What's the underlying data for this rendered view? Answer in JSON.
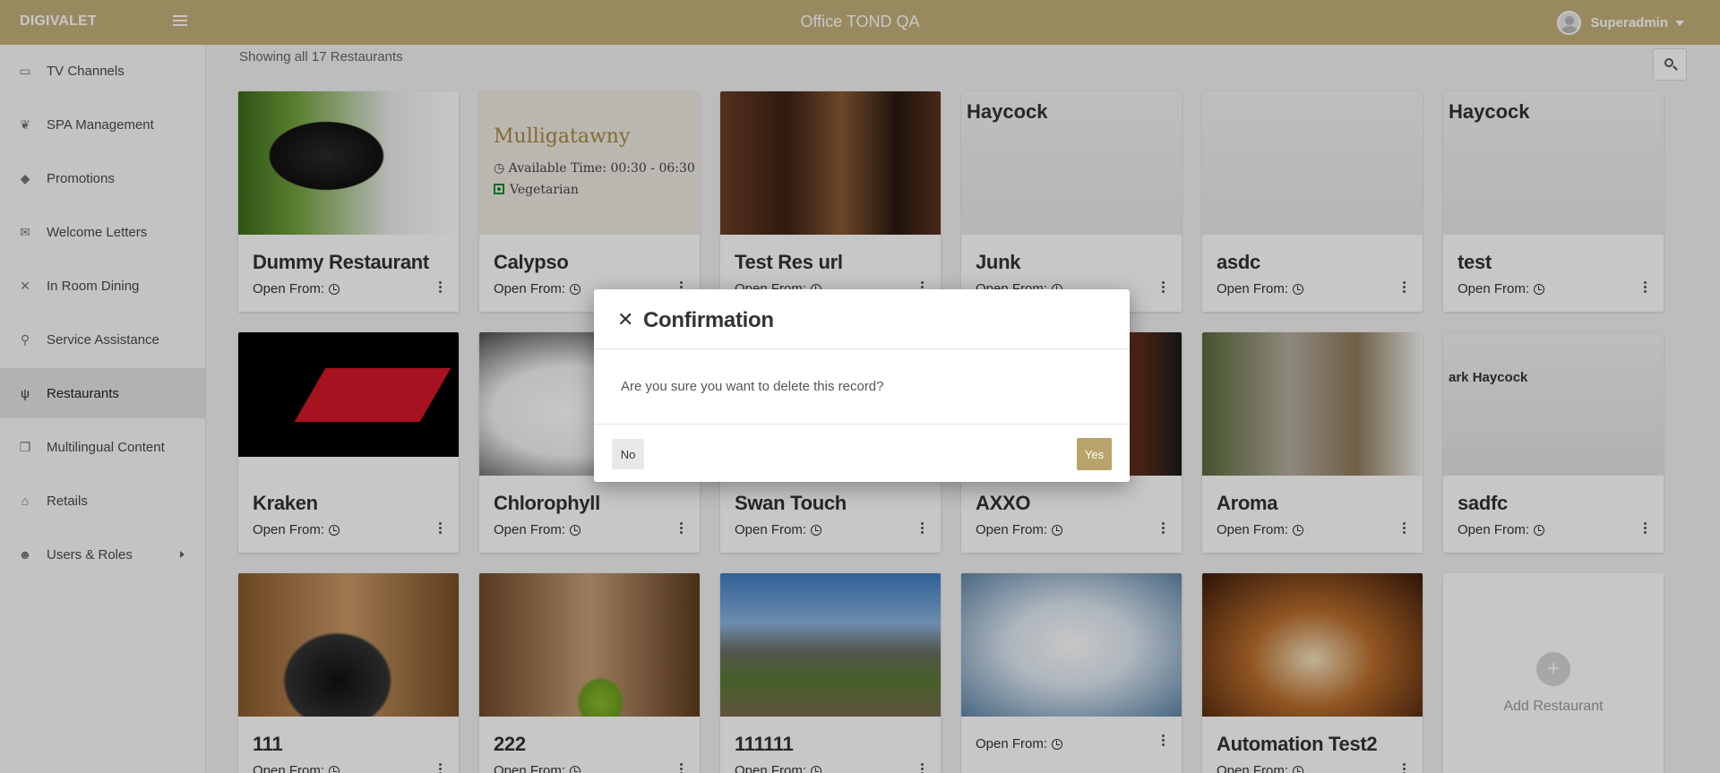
{
  "header": {
    "brand": "DIGIVALET",
    "app_title": "Office TOND QA",
    "user_name": "Superadmin"
  },
  "sidebar": {
    "items": [
      {
        "label": "TV Channels",
        "icon": "tv-icon"
      },
      {
        "label": "SPA Management",
        "icon": "spa-icon"
      },
      {
        "label": "Promotions",
        "icon": "tag-icon"
      },
      {
        "label": "Welcome Letters",
        "icon": "envelope-icon"
      },
      {
        "label": "In Room Dining",
        "icon": "cutlery-icon"
      },
      {
        "label": "Service Assistance",
        "icon": "bell-icon"
      },
      {
        "label": "Restaurants",
        "icon": "fork-knife-icon",
        "active": true
      },
      {
        "label": "Multilingual Content",
        "icon": "copy-icon"
      },
      {
        "label": "Retails",
        "icon": "basket-icon"
      },
      {
        "label": "Users & Roles",
        "icon": "user-icon"
      }
    ]
  },
  "main": {
    "showing_text": "Showing all 17 Restaurants",
    "open_from_label": "Open From:",
    "add_label": "Add Restaurant",
    "mulligatawny": {
      "title": "Mulligatawny",
      "time": "Available Time: 00:30 - 06:30",
      "diet": "Vegetarian"
    },
    "haycock_text": "Haycock",
    "restaurants": [
      {
        "name": "Dummy Restaurant"
      },
      {
        "name": "Calypso"
      },
      {
        "name": "Test Res url"
      },
      {
        "name": "Junk"
      },
      {
        "name": "asdc"
      },
      {
        "name": "test"
      },
      {
        "name": "Kraken"
      },
      {
        "name": "Chlorophyll"
      },
      {
        "name": "Swan Touch"
      },
      {
        "name": "AXXO"
      },
      {
        "name": "Aroma"
      },
      {
        "name": "sadfc"
      },
      {
        "name": "111"
      },
      {
        "name": "222"
      },
      {
        "name": "111111"
      },
      {
        "name": ""
      },
      {
        "name": "Automation Test2"
      }
    ]
  },
  "modal": {
    "title": "Confirmation",
    "message": "Are you sure you want to delete this record?",
    "no_label": "No",
    "yes_label": "Yes"
  },
  "colors": {
    "brand": "#c4b07a",
    "yes_button": "#b8a46a"
  }
}
